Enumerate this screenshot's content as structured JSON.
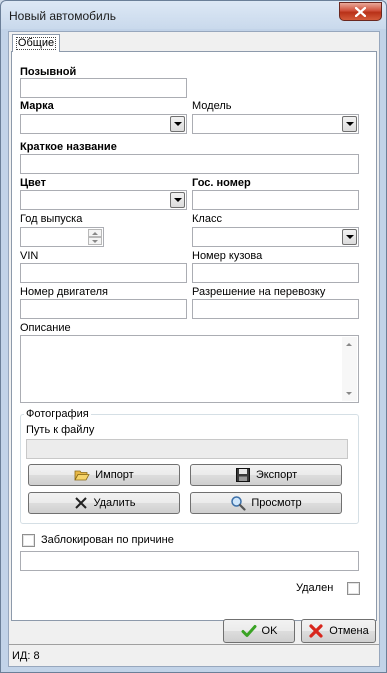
{
  "window": {
    "title": "Новый автомобиль"
  },
  "tabs": [
    {
      "label": "Общие"
    }
  ],
  "fields": {
    "callsign": {
      "label": "Позывной",
      "value": ""
    },
    "make": {
      "label": "Марка",
      "value": ""
    },
    "model": {
      "label": "Модель",
      "value": ""
    },
    "short_name": {
      "label": "Краткое название",
      "value": ""
    },
    "color": {
      "label": "Цвет",
      "value": ""
    },
    "plate": {
      "label": "Гос. номер",
      "value": ""
    },
    "year": {
      "label": "Год выпуска",
      "value": ""
    },
    "vehicle_class": {
      "label": "Класс",
      "value": ""
    },
    "vin": {
      "label": "VIN",
      "value": ""
    },
    "body_number": {
      "label": "Номер кузова",
      "value": ""
    },
    "engine_number": {
      "label": "Номер двигателя",
      "value": ""
    },
    "transport_permit": {
      "label": "Разрешение на перевозку",
      "value": ""
    },
    "description": {
      "label": "Описание",
      "value": ""
    }
  },
  "photo": {
    "group_title": "Фотография",
    "path_label": "Путь к файлу",
    "path_value": "",
    "import_label": "Импорт",
    "export_label": "Экспорт",
    "delete_label": "Удалить",
    "view_label": "Просмотр"
  },
  "blocked": {
    "label": "Заблокирован по причине",
    "checked": false,
    "reason": ""
  },
  "deleted": {
    "label": "Удален",
    "checked": false
  },
  "buttons": {
    "ok": "OK",
    "cancel": "Отмена"
  },
  "status": {
    "id_text": "ИД: 8"
  },
  "icons": {
    "close": "close-icon",
    "import": "folder-open-icon",
    "export": "floppy-disk-icon",
    "delete": "x-delete-icon",
    "view": "magnifier-icon",
    "ok": "checkmark-icon",
    "cancel": "red-x-icon"
  }
}
